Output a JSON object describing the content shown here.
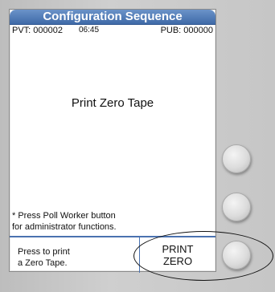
{
  "header": {
    "title": "Configuration Sequence",
    "pvt": "PVT: 000002",
    "time": "06:45",
    "pub": "PUB: 000000"
  },
  "main": {
    "message": "Print Zero Tape",
    "footnote_line1": "* Press Poll Worker button",
    "footnote_line2": "for administrator functions."
  },
  "bottom": {
    "instruction_line1": "Press to print",
    "instruction_line2": "a Zero Tape.",
    "action_line1": "PRINT",
    "action_line2": "ZERO"
  }
}
